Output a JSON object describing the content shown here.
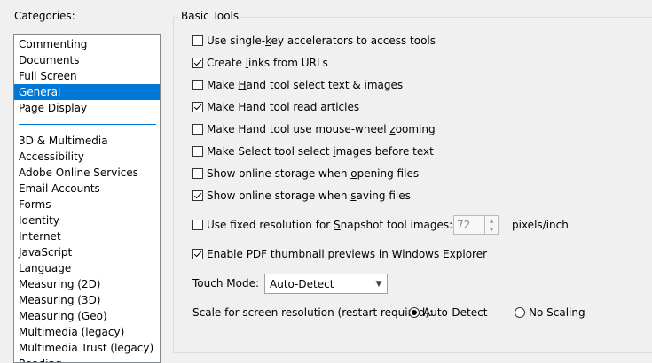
{
  "categories": {
    "label": "Categories:",
    "group1": [
      "Commenting",
      "Documents",
      "Full Screen",
      "General",
      "Page Display"
    ],
    "group2": [
      "3D & Multimedia",
      "Accessibility",
      "Adobe Online Services",
      "Email Accounts",
      "Forms",
      "Identity",
      "Internet",
      "JavaScript",
      "Language",
      "Measuring (2D)",
      "Measuring (3D)",
      "Measuring (Geo)",
      "Multimedia (legacy)",
      "Multimedia Trust (legacy)",
      "Reading"
    ],
    "selected": "General"
  },
  "basic_tools": {
    "title": "Basic Tools",
    "options": [
      {
        "pre": "Use single-",
        "key": "k",
        "post": "ey accelerators to access tools",
        "checked": false
      },
      {
        "pre": "Create ",
        "key": "l",
        "post": "inks from URLs",
        "checked": true
      },
      {
        "pre": "Make ",
        "key": "H",
        "post": "and tool select text & images",
        "checked": false
      },
      {
        "pre": "Make Hand tool read ",
        "key": "a",
        "post": "rticles",
        "checked": true
      },
      {
        "pre": "Make Hand tool use mouse-wheel ",
        "key": "z",
        "post": "ooming",
        "checked": false
      },
      {
        "pre": "Make Select tool select ",
        "key": "i",
        "post": "mages before text",
        "checked": false
      },
      {
        "pre": "Show online storage when ",
        "key": "o",
        "post": "pening files",
        "checked": false
      },
      {
        "pre": "Show online storage when ",
        "key": "s",
        "post": "aving files",
        "checked": true
      }
    ],
    "snapshot": {
      "pre": "Use fixed resolution for ",
      "key": "S",
      "post": "napshot tool images:",
      "checked": false,
      "value": "72",
      "units": "pixels/inch"
    },
    "thumbnail": {
      "pre": "Enable PDF thumb",
      "key": "n",
      "post": "ail previews in Windows Explorer",
      "checked": true
    },
    "touch_mode": {
      "label": "Touch Mode:",
      "value": "Auto-Detect"
    },
    "scale": {
      "label": "Scale for screen resolution (restart required):",
      "auto": "Auto-Detect",
      "none": "No Scaling",
      "selected": "Auto-Detect"
    }
  },
  "icons": {
    "dropdown": "chevron-down-icon",
    "spin": "spin-arrows-icon"
  }
}
